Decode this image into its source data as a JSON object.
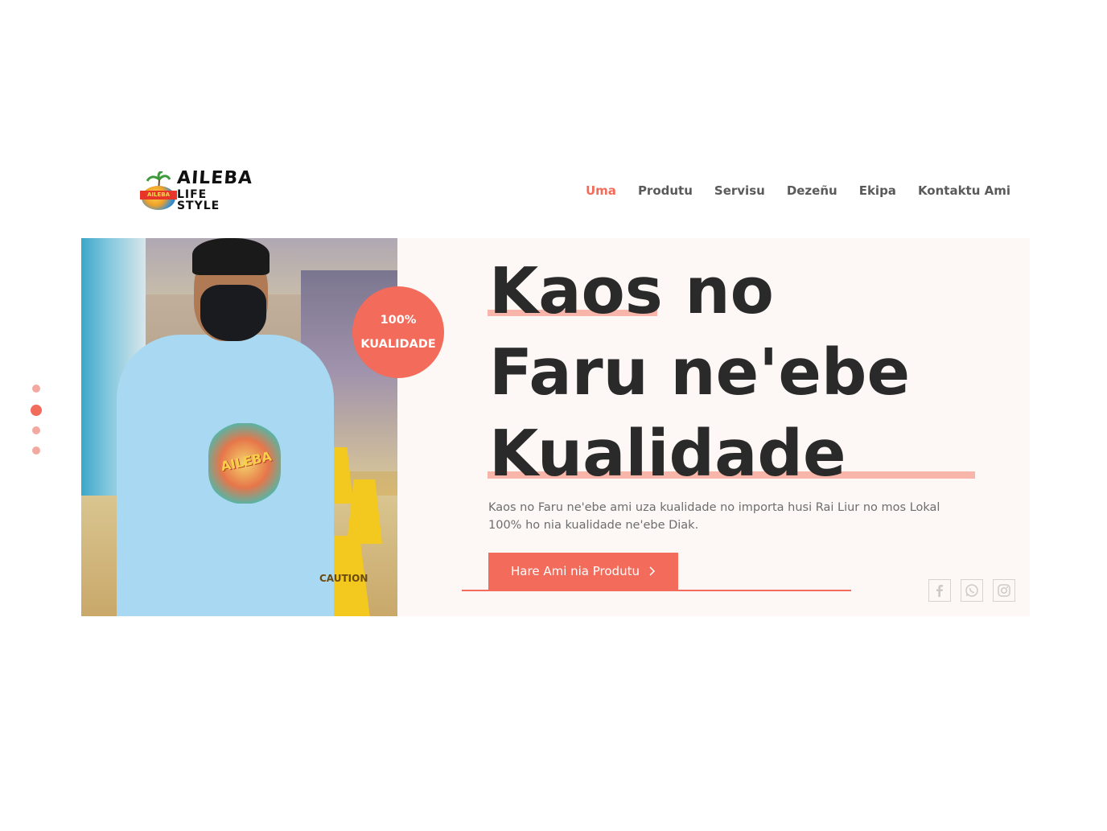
{
  "brand": {
    "line1": "AILEBA",
    "line2": "LIFE STYLE",
    "badge_small": "AILEBA"
  },
  "nav": {
    "items": [
      {
        "label": "Uma",
        "active": true
      },
      {
        "label": "Produtu"
      },
      {
        "label": "Servisu"
      },
      {
        "label": "Dezeñu"
      },
      {
        "label": "Ekipa"
      },
      {
        "label": "Kontaktu Ami"
      }
    ]
  },
  "slider": {
    "dot_count": 4,
    "active_index": 1
  },
  "hero": {
    "badge_line1": "100%",
    "badge_line2": "KUALIDADE",
    "headline_line1": "Kaos no",
    "headline_line2": "Faru ne'ebe",
    "headline_line3": "Kualidade",
    "description": "Kaos no Faru ne'ebe ami uza kualidade no importa husi Rai Liur no mos Lokal 100% ho nia kualidade ne'ebe Diak.",
    "cta_label": "Hare Ami nia Produtu",
    "shirt_print": "AILEBA",
    "sign_text": "CAUTION"
  },
  "social": [
    "facebook-icon",
    "whatsapp-icon",
    "instagram-icon"
  ],
  "colors": {
    "accent": "#f26b5b",
    "accent_light": "#f8b5a9",
    "hero_bg": "#fdf8f5"
  }
}
